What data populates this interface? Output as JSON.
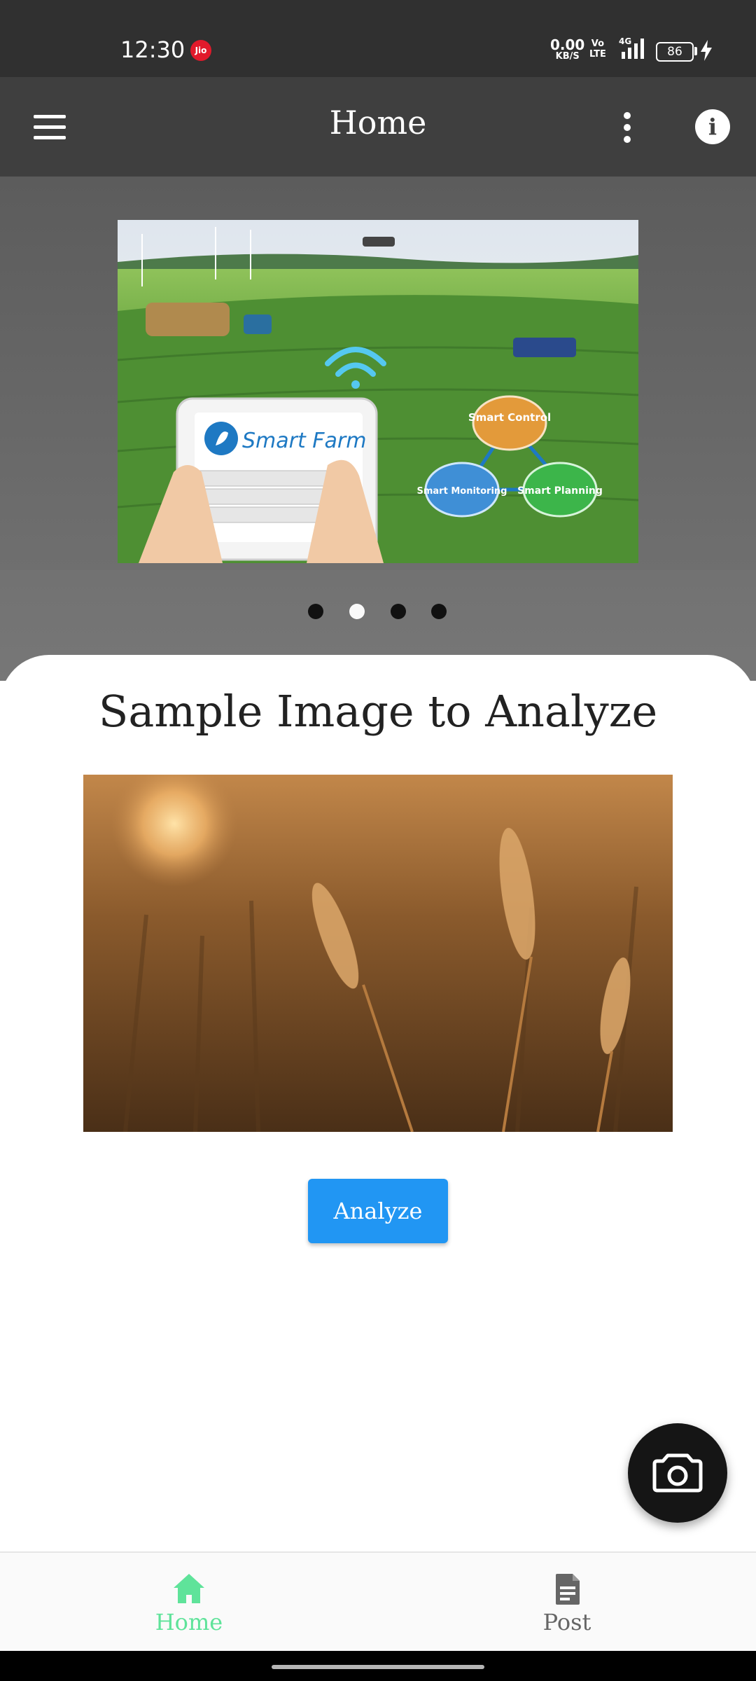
{
  "status_bar": {
    "time": "12:30",
    "carrier_badge": "Jio",
    "net_speed_value": "0.00",
    "net_speed_unit": "KB/S",
    "volte_line1": "Vo",
    "volte_line2": "LTE",
    "network": "4G",
    "battery": "86"
  },
  "app_bar": {
    "title": "Home",
    "menu_icon": "hamburger-menu-icon",
    "more_icon": "more-vertical-icon",
    "info_icon": "info-icon"
  },
  "carousel": {
    "banner_text": "Smart Farm",
    "nodes": [
      "Smart Control",
      "Smart Monitoring",
      "Smart Planning"
    ],
    "page_count": 4,
    "active_index": 1
  },
  "card": {
    "title": "Sample Image to Analyze",
    "analyze_label": "Analyze"
  },
  "fab": {
    "icon": "camera-icon"
  },
  "bottom_nav": {
    "items": [
      {
        "label": "Home",
        "icon": "home-icon",
        "active": true
      },
      {
        "label": "Post",
        "icon": "document-icon",
        "active": false
      }
    ]
  },
  "colors": {
    "app_bar": "#3f3f3f",
    "status_bar": "#303030",
    "accent_button": "#2196f3",
    "nav_active": "#5fe39a",
    "fab": "#151515"
  }
}
